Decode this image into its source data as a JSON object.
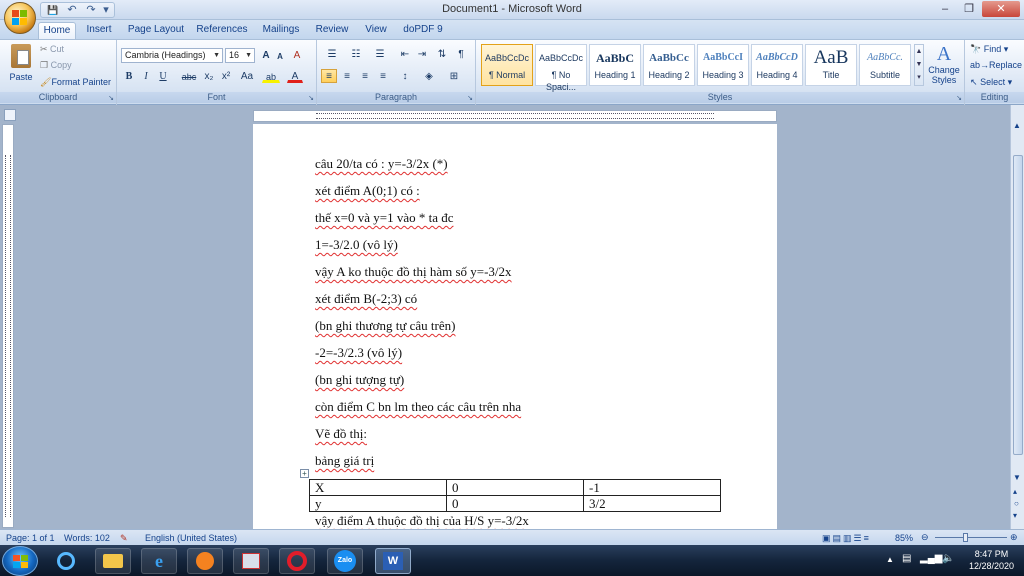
{
  "window": {
    "title": "Document1 - Microsoft Word",
    "minimize": "–",
    "restore": "❐",
    "close": "✕"
  },
  "qat": {
    "save": "💾",
    "undo": "↶",
    "redo": "↷",
    "more": "▾"
  },
  "tabs": [
    "Home",
    "Insert",
    "Page Layout",
    "References",
    "Mailings",
    "Review",
    "View",
    "doPDF 9"
  ],
  "ribbon": {
    "clipboard": {
      "label": "Clipboard",
      "paste": "Paste",
      "cut": "Cut",
      "copy": "Copy",
      "format_painter": "Format Painter"
    },
    "font": {
      "label": "Font",
      "name": "Cambria (Headings)",
      "size": "16",
      "bold": "B",
      "italic": "I",
      "underline": "U",
      "strike": "abc",
      "subscript": "x₂",
      "superscript": "x²",
      "change_case": "Aa",
      "grow": "A",
      "shrink": "A",
      "clear": "A",
      "highlight": "ab",
      "color": "A"
    },
    "paragraph": {
      "label": "Paragraph"
    },
    "styles": {
      "label": "Styles",
      "items": [
        {
          "preview": "AaBbCcDc",
          "name": "¶ Normal"
        },
        {
          "preview": "AaBbCcDc",
          "name": "¶ No Spaci..."
        },
        {
          "preview": "AaBbC",
          "name": "Heading 1"
        },
        {
          "preview": "AaBbCc",
          "name": "Heading 2"
        },
        {
          "preview": "AaBbCcI",
          "name": "Heading 3"
        },
        {
          "preview": "AaBbCcD",
          "name": "Heading 4"
        },
        {
          "preview": "AaB",
          "name": "Title"
        },
        {
          "preview": "AaBbCc.",
          "name": "Subtitle"
        }
      ],
      "change_styles": "Change Styles"
    },
    "editing": {
      "label": "Editing",
      "find": "Find",
      "replace": "Replace",
      "select": "Select"
    }
  },
  "document": {
    "lines": [
      "câu 20/ta có : y=-3/2x (*)",
      "xét  điểm A(0;1) có :",
      "thế x=0 và y=1 vào * ta đc",
      "1=-3/2.0 (vô  lý)",
      "vậy A ko thuộc  đồ thị hàm số y=-3/2x",
      "xét điểm B(-2;3) có",
      "(bn ghi thương tự câu trên)",
      "-2=-3/2.3 (vô lý)",
      "(bn ghi tượng tự)",
      "còn điểm C bn lm theo các câu trên nha",
      "Vẽ đồ thị:",
      "bảng  giá trị"
    ],
    "table": [
      [
        "X",
        "0",
        "-1"
      ],
      [
        "y",
        "0",
        "3/2"
      ]
    ],
    "after_table": "vậy điểm A thuộc đồ thị của H/S y=-3/2x"
  },
  "status": {
    "page": "Page: 1 of 1",
    "words": "Words: 102",
    "language": "English (United States)",
    "zoom": "85%"
  },
  "taskbar": {
    "zalo": "Zalo",
    "time": "8:47 PM",
    "date": "12/28/2020"
  },
  "colors": {
    "ribbon_text": "#15428b",
    "accent": "#e3a21a"
  }
}
